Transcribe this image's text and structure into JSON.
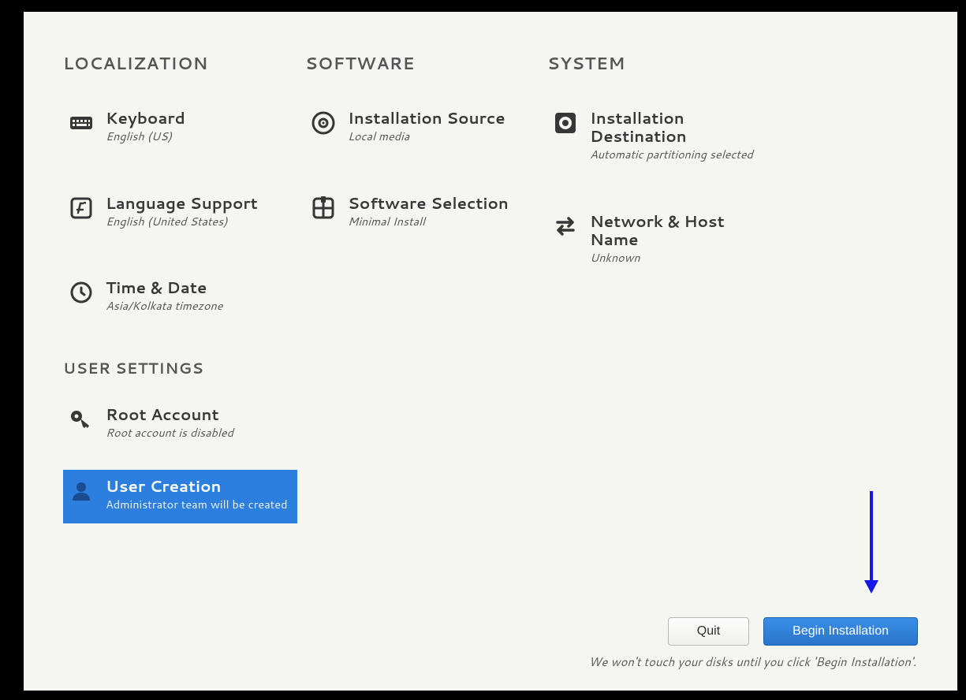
{
  "sections": {
    "localization": {
      "header": "LOCALIZATION",
      "keyboard": {
        "title": "Keyboard",
        "sub": "English (US)"
      },
      "language": {
        "title": "Language Support",
        "sub": "English (United States)"
      },
      "time": {
        "title": "Time & Date",
        "sub": "Asia/Kolkata timezone"
      }
    },
    "software": {
      "header": "SOFTWARE",
      "source": {
        "title": "Installation Source",
        "sub": "Local media"
      },
      "selection": {
        "title": "Software Selection",
        "sub": "Minimal Install"
      }
    },
    "system": {
      "header": "SYSTEM",
      "destination": {
        "title": "Installation Destination",
        "sub": "Automatic partitioning selected"
      },
      "network": {
        "title": "Network & Host Name",
        "sub": "Unknown"
      }
    },
    "user": {
      "header": "USER SETTINGS",
      "root": {
        "title": "Root Account",
        "sub": "Root account is disabled"
      },
      "create": {
        "title": "User Creation",
        "sub": "Administrator team will be created"
      }
    }
  },
  "footer": {
    "quit": "Quit",
    "begin": "Begin Installation",
    "disclaimer": "We won't touch your disks until you click 'Begin Installation'."
  }
}
